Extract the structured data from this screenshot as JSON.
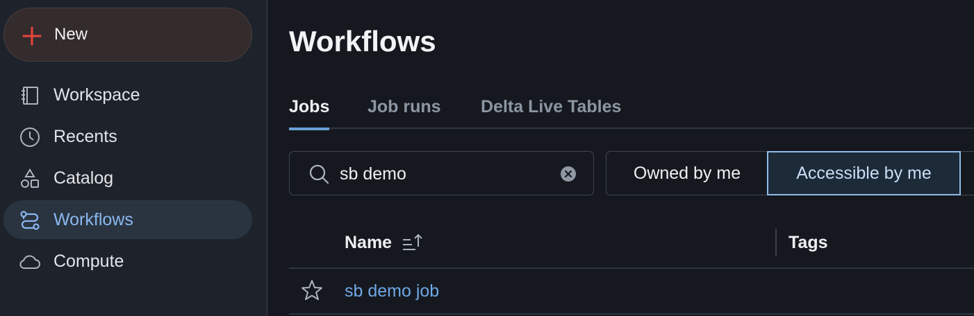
{
  "sidebar": {
    "new_label": "New",
    "items": [
      {
        "label": "Workspace",
        "icon": "workspace-icon"
      },
      {
        "label": "Recents",
        "icon": "clock-icon"
      },
      {
        "label": "Catalog",
        "icon": "catalog-icon"
      },
      {
        "label": "Workflows",
        "icon": "workflows-icon",
        "active": true
      },
      {
        "label": "Compute",
        "icon": "cloud-icon"
      }
    ]
  },
  "main": {
    "title": "Workflows",
    "tabs": [
      {
        "label": "Jobs",
        "active": true
      },
      {
        "label": "Job runs"
      },
      {
        "label": "Delta Live Tables"
      }
    ],
    "search": {
      "value": "sb demo",
      "placeholder": ""
    },
    "filters": {
      "owned_label": "Owned by me",
      "accessible_label": "Accessible by me",
      "selected": "Accessible by me"
    },
    "table": {
      "columns": [
        "Name",
        "Tags"
      ],
      "rows": [
        {
          "name": "sb demo job"
        }
      ]
    }
  },
  "colors": {
    "accent": "#6aa0d8",
    "link": "#6fa8e6",
    "new_plus": "#e8463a"
  }
}
